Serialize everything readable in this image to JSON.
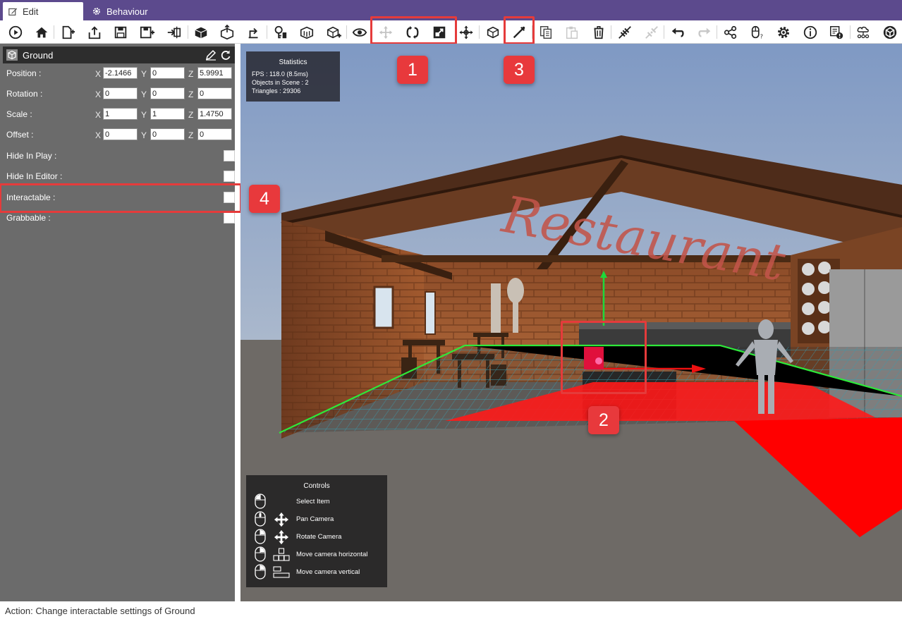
{
  "tabs": {
    "edit": "Edit",
    "behaviour": "Behaviour"
  },
  "toolbar": {
    "buttons": [
      "play-icon",
      "home-icon",
      "new-scene-icon",
      "open-scene-icon",
      "save-icon",
      "save-as-icon",
      "import-icon",
      "package-icon",
      "export-icon",
      "publish-icon",
      "login-icon",
      "asset-store-icon",
      "add-object-icon",
      "visibility-icon",
      "move-tool-icon",
      "rotate-tool-icon",
      "scale-tool-icon",
      "pivot-icon",
      "object-mode-icon",
      "interaction-tool-icon",
      "copy-icon",
      "paste-icon",
      "delete-icon",
      "link-icon",
      "unlink-icon",
      "undo-icon",
      "redo-icon",
      "share-icon",
      "mouse-help-icon",
      "settings-icon",
      "info-icon",
      "report-icon",
      "network-icon",
      "unity-logo-icon"
    ]
  },
  "inspector": {
    "object_name": "Ground",
    "position": {
      "label": "Position :",
      "x": "-2.1466",
      "y": "0",
      "z": "5.9991"
    },
    "rotation": {
      "label": "Rotation :",
      "x": "0",
      "y": "0",
      "z": "0"
    },
    "scale": {
      "label": "Scale :",
      "x": "1",
      "y": "1",
      "z": "1.4750"
    },
    "offset": {
      "label": "Offset :",
      "x": "0",
      "y": "0",
      "z": "0"
    },
    "axis_labels": {
      "x": "X",
      "y": "Y",
      "z": "Z"
    },
    "toggles": [
      {
        "label": "Hide In Play :",
        "checked": false
      },
      {
        "label": "Hide In Editor :",
        "checked": false
      },
      {
        "label": "Interactable :",
        "checked": false
      },
      {
        "label": "Grabbable :",
        "checked": false
      }
    ]
  },
  "statistics": {
    "title": "Statistics",
    "fps": "FPS : 118.0 (8.5ms)",
    "objects": "Objects in Scene : 2",
    "triangles": "Triangles : 29306"
  },
  "controls": {
    "title": "Controls",
    "items": [
      "Select Item",
      "Pan Camera",
      "Rotate Camera",
      "Move camera horizontal",
      "Move camera vertical"
    ]
  },
  "annotations": {
    "a1": "1",
    "a2": "2",
    "a3": "3",
    "a4": "4"
  },
  "scene": {
    "sign_text": "Restaurant"
  },
  "status": {
    "action": "Action: Change interactable settings of Ground"
  },
  "colors": {
    "tabbar": "#5c4a8d",
    "panel": "#6b6b6b",
    "header": "#2d2d2d",
    "highlight": "#e53b3b",
    "sky": "#8ba3c9",
    "floor_grid": "#3fbfd8",
    "selection": "#ff1a1a"
  }
}
